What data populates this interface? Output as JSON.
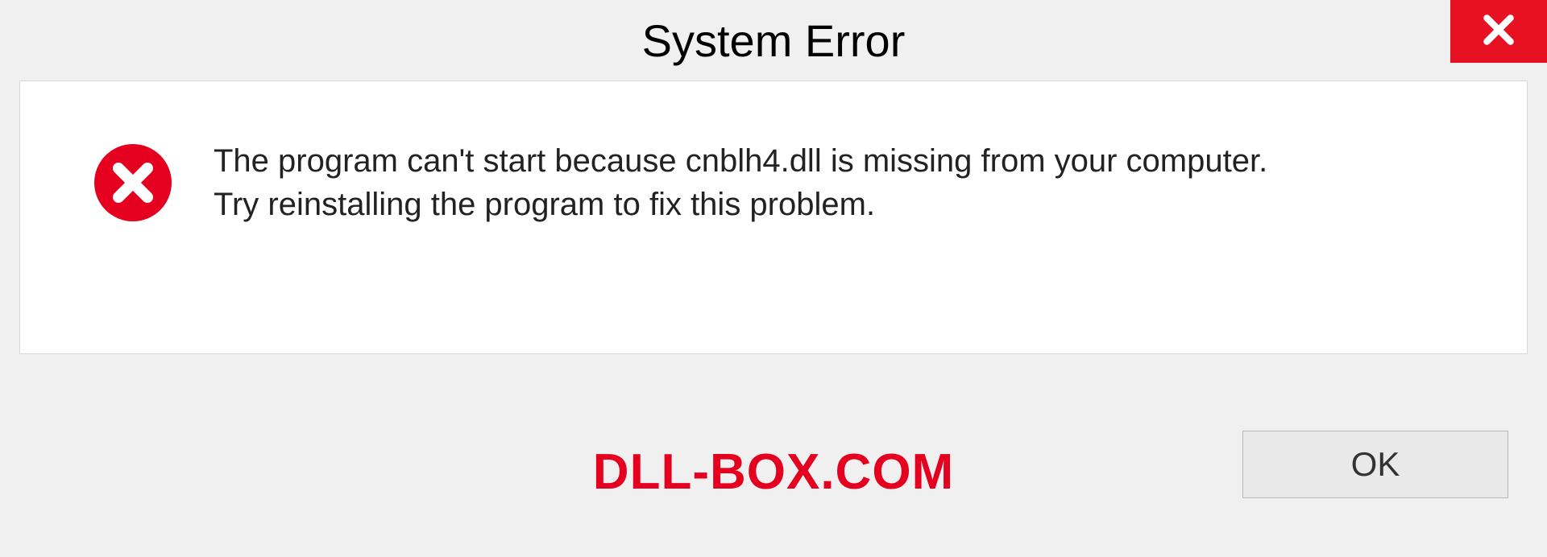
{
  "window": {
    "title": "System Error"
  },
  "message": {
    "line1": "The program can't start because cnblh4.dll is missing from your computer.",
    "line2": "Try reinstalling the program to fix this problem."
  },
  "watermark": "DLL-BOX.COM",
  "buttons": {
    "ok": "OK"
  },
  "colors": {
    "close_bg": "#e81123",
    "error_icon": "#e4001e",
    "watermark": "#e4001e"
  }
}
